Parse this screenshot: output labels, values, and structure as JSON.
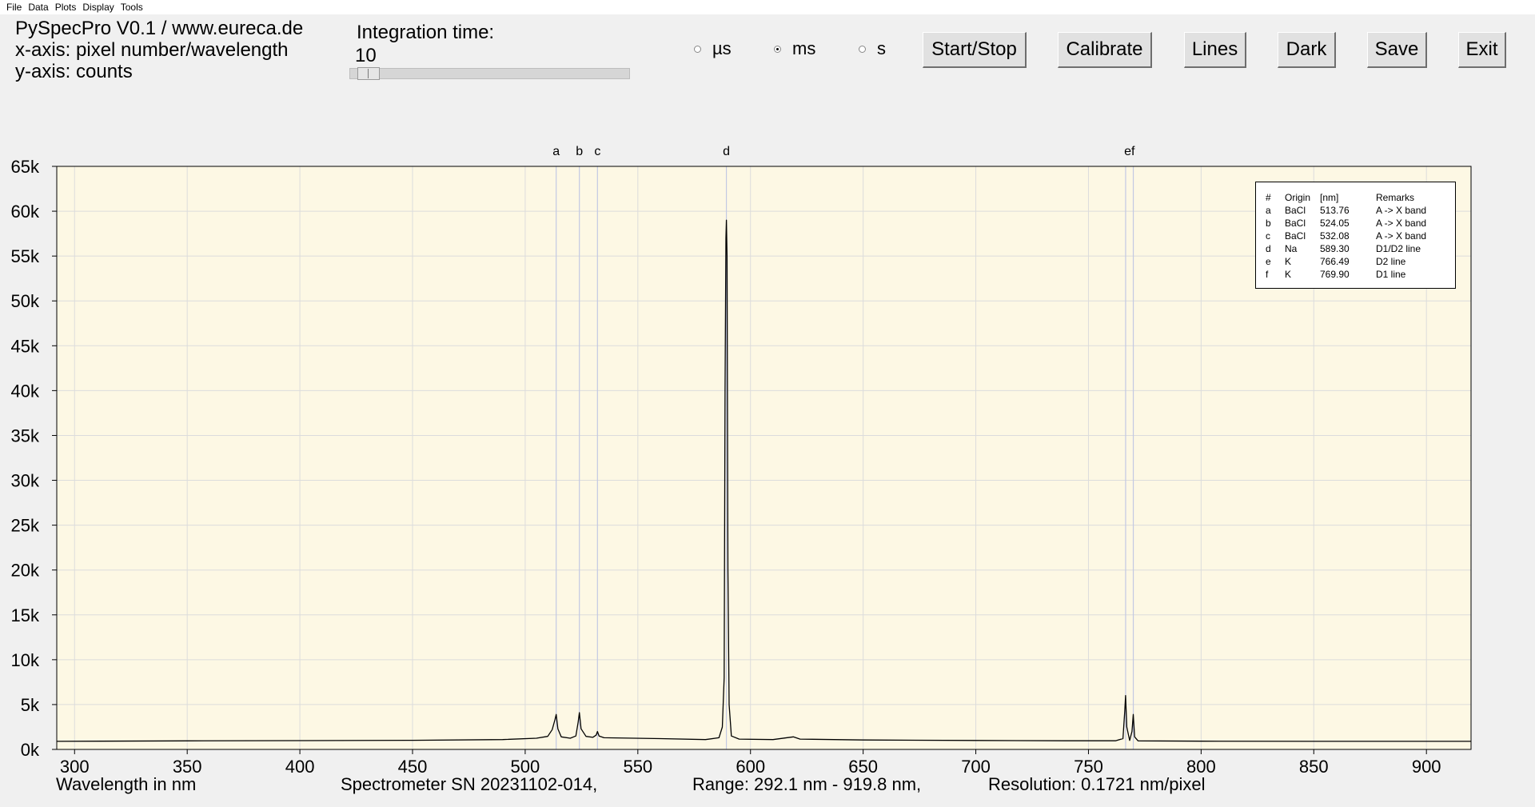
{
  "menu": {
    "items": [
      "File",
      "Data",
      "Plots",
      "Display",
      "Tools"
    ]
  },
  "info": {
    "title": "PySpecPro V0.1 / www.eureca.de",
    "xaxis": "x-axis: pixel number/wavelength",
    "yaxis": "y-axis: counts"
  },
  "integration": {
    "label": "Integration time:",
    "value": "10",
    "slider_fraction": 0.02
  },
  "units": {
    "options": [
      "µs",
      "ms",
      "s"
    ],
    "selected": "ms"
  },
  "buttons": {
    "start_stop": "Start/Stop",
    "calibrate": "Calibrate",
    "lines": "Lines",
    "dark": "Dark",
    "save": "Save",
    "exit": "Exit"
  },
  "footer": {
    "xlabel": "Wavelength in nm",
    "serial": "Spectrometer SN 20231102-014,",
    "range": "Range: 292.1 nm - 919.8 nm,",
    "resolution": "Resolution: 0.1721 nm/pixel"
  },
  "legend": {
    "headers": [
      "#",
      "Origin",
      "[nm]",
      "Remarks"
    ],
    "rows": [
      [
        "a",
        "BaCl",
        "513.76",
        "A -> X band"
      ],
      [
        "b",
        "BaCl",
        "524.05",
        "A -> X band"
      ],
      [
        "c",
        "BaCl",
        "532.08",
        "A -> X band"
      ],
      [
        "d",
        "Na",
        "589.30",
        "D1/D2 line"
      ],
      [
        "e",
        "K",
        "766.49",
        "D2 line"
      ],
      [
        "f",
        "K",
        "769.90",
        "D1 line"
      ]
    ]
  },
  "colors": {
    "plot_background": "#fdf8e4",
    "marker_line": "#c3c9e3",
    "grid": "#dcdcdc",
    "trace": "#000000"
  },
  "chart_data": {
    "type": "line",
    "xlabel": "Wavelength in nm",
    "ylabel": "",
    "xlim": [
      292.1,
      919.8
    ],
    "ylim": [
      0,
      65000
    ],
    "x_ticks": [
      300,
      350,
      400,
      450,
      500,
      550,
      600,
      650,
      700,
      750,
      800,
      850,
      900
    ],
    "y_ticks": [
      0,
      5000,
      10000,
      15000,
      20000,
      25000,
      30000,
      35000,
      40000,
      45000,
      50000,
      55000,
      60000,
      65000
    ],
    "y_tick_labels": [
      "0k",
      "5k",
      "10k",
      "15k",
      "20k",
      "25k",
      "30k",
      "35k",
      "40k",
      "45k",
      "50k",
      "55k",
      "60k",
      "65k"
    ],
    "grid": true,
    "markers": [
      {
        "label": "a",
        "x": 513.76
      },
      {
        "label": "b",
        "x": 524.05
      },
      {
        "label": "c",
        "x": 532.08
      },
      {
        "label": "d",
        "x": 589.3
      },
      {
        "label": "e",
        "x": 766.49
      },
      {
        "label": "f",
        "x": 769.9
      }
    ],
    "marker_labels": [
      {
        "text": "a",
        "x": 513.76
      },
      {
        "text": "b",
        "x": 524.05
      },
      {
        "text": "c",
        "x": 532.08
      },
      {
        "text": "d",
        "x": 589.3
      },
      {
        "text": "ef",
        "x": 768.2
      }
    ],
    "series": [
      {
        "x": [
          292.1,
          350,
          400,
          450,
          490,
          505,
          510,
          512,
          513.2,
          513.76,
          514.5,
          516,
          520,
          522.5,
          523.5,
          524.05,
          524.8,
          527,
          530,
          531.5,
          532.08,
          532.8,
          535,
          560,
          580,
          586,
          587.5,
          588.3,
          588.7,
          589.1,
          589.3,
          589.6,
          590,
          590.5,
          591.5,
          595,
          610,
          619,
          622,
          650,
          700,
          740,
          762,
          765.3,
          766.1,
          766.49,
          767,
          768.3,
          769.3,
          769.9,
          770.5,
          772,
          800,
          850,
          919.8
        ],
        "y": [
          900,
          950,
          980,
          1020,
          1100,
          1250,
          1450,
          2200,
          3300,
          3900,
          2300,
          1400,
          1250,
          1500,
          3000,
          4100,
          2300,
          1450,
          1350,
          1600,
          2000,
          1500,
          1300,
          1200,
          1100,
          1300,
          2500,
          8000,
          40000,
          57000,
          59000,
          55000,
          20000,
          5000,
          1500,
          1150,
          1100,
          1400,
          1150,
          1050,
          1000,
          960,
          960,
          1200,
          4200,
          6000,
          2500,
          1000,
          2000,
          3900,
          1400,
          950,
          920,
          900,
          900
        ]
      }
    ]
  }
}
